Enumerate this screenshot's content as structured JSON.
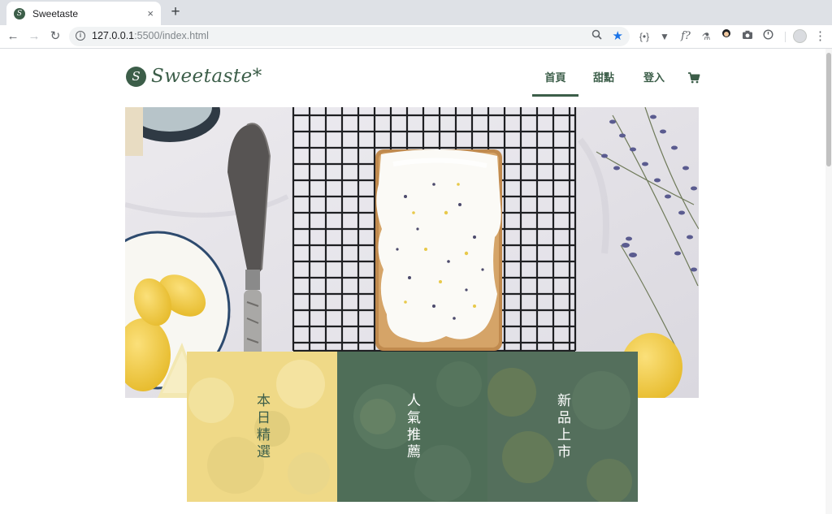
{
  "browser": {
    "tab_title": "Sweetaste",
    "tab_close": "×",
    "new_tab": "+",
    "url_host": "127.0.0.1",
    "url_rest": ":5500/index.html"
  },
  "site": {
    "logo_text": "Sweetaste*",
    "logo_mark": "S",
    "nav": [
      {
        "label": "首頁",
        "active": true
      },
      {
        "label": "甜點",
        "active": false
      },
      {
        "label": "登入",
        "active": false
      }
    ]
  },
  "cards": [
    {
      "label": "本日精選",
      "color": "#3c5e49",
      "bg": "#efd987"
    },
    {
      "label": "人氣推薦",
      "color": "#ffffff",
      "bg": "#4f6e58"
    },
    {
      "label": "新品上市",
      "color": "#ffffff",
      "bg": "#546f5c"
    }
  ],
  "colors": {
    "brand": "#3c5e49",
    "bookmark_star": "#1a73e8"
  }
}
